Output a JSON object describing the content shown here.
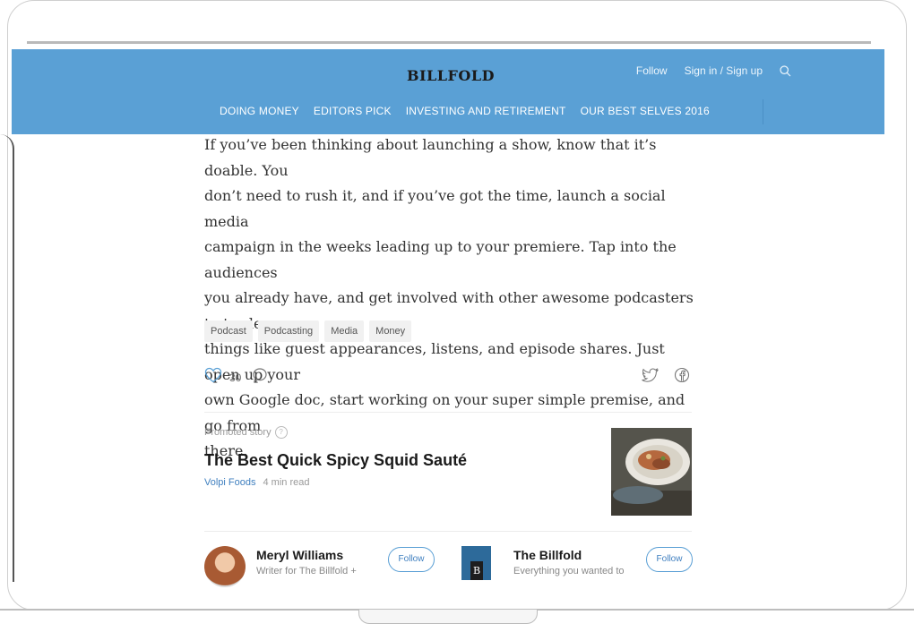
{
  "header": {
    "logo": "BILLFOLD",
    "follow_label": "Follow",
    "sign_in_label": "Sign in / Sign up",
    "search_icon": "search-icon",
    "nav": [
      {
        "label": "DOING MONEY"
      },
      {
        "label": "EDITORS PICK"
      },
      {
        "label": "INVESTING AND RETIREMENT"
      },
      {
        "label": "OUR BEST SELVES 2016"
      }
    ],
    "accent_color": "#5aa0d5"
  },
  "article": {
    "lines": [
      "If you’ve been thinking about launching a show, know that it’s doable. You",
      "don’t need to rush it, and if you’ve got the time, launch a social media",
      "campaign in the weeks leading up to your premiere. Tap into the audiences",
      "you already have, and get involved with other awesome podcasters to trade",
      "things like guest appearances, listens, and episode shares. Just open up your",
      "own Google doc, start working on your super simple premise, and go from",
      "there."
    ],
    "tags": [
      "Podcast",
      "Podcasting",
      "Media",
      "Money"
    ],
    "likes": "30"
  },
  "promoted": {
    "label": "Promoted story",
    "help": "?",
    "title": "The Best Quick Spicy Squid Sauté",
    "author": "Volpi Foods",
    "read_time": "4 min read"
  },
  "cards": [
    {
      "name": "Meryl Williams",
      "bio": "Writer for The Billfold +",
      "follow": "Follow"
    },
    {
      "name": "The Billfold",
      "bio": "Everything you wanted to",
      "follow": "Follow",
      "logo_letter": "B"
    }
  ]
}
